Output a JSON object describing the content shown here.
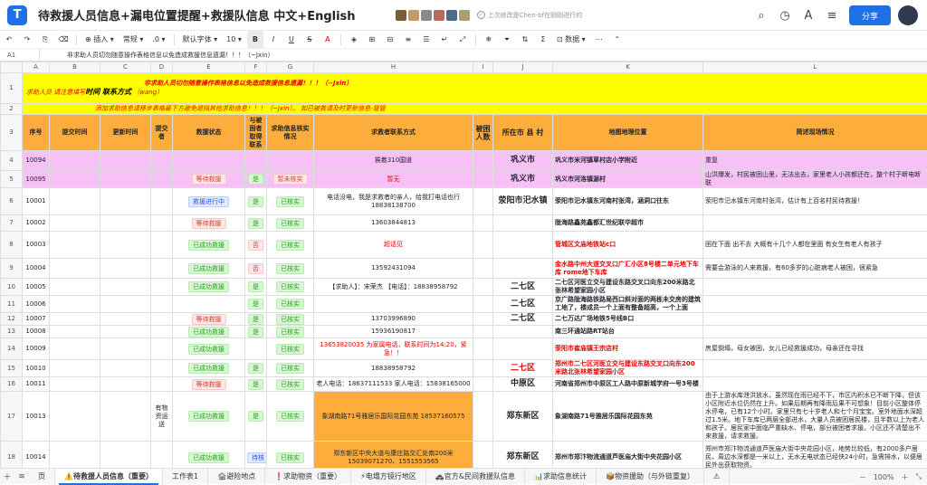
{
  "app": {
    "title": "待救援人员信息+漏电位置提醒+救援队信息 中文+English",
    "save_status": "上次修改是Chen-bf在刚刚进行的",
    "share_label": "分享",
    "logo": "doc-icon"
  },
  "toolbar": {
    "insert_label": "插入",
    "format_label": "常规",
    "decimal_label": ".0",
    "font_label": "默认字体",
    "size_label": "10",
    "data_label": "数据"
  },
  "formula_bar": {
    "cell_ref": "A1",
    "content": "非求助人员切勿随意操作表格信息以免造成救援信息遗漏！！！（~Jxin）"
  },
  "columns": [
    "A",
    "B",
    "C",
    "D",
    "E",
    "F",
    "G",
    "H",
    "I",
    "J",
    "K",
    "L"
  ],
  "banner": {
    "line1": "非求助人员切勿随意操作表格信息以免造成救援信息遗漏！！！（~Jxin）",
    "line2a": "求助人员 请注意填写",
    "line2b": "时间 联系方式",
    "line2c": "（wang）",
    "line3": "添加求助信息请移步表格最下方避免遮挡其他求助信息！！！（~Jxin）。 如已被救请及时更新信息-管管"
  },
  "headers": {
    "a": "序号",
    "b": "提交时间",
    "c": "更新时间",
    "d": "提交者",
    "e": "救援状态",
    "f": "与被困者取得联系",
    "g": "求助信息核实情况",
    "h": "求救者联系方式",
    "i": "被困人数",
    "j": "所在市 县 村",
    "k": "地图地理位置",
    "l": "简述现场情况"
  },
  "rows": [
    {
      "n": "4",
      "a": "10094",
      "e": "",
      "f": "",
      "g": "",
      "h": "挨着310国道",
      "j": "巩义市",
      "k": "巩义市米河镇草村店小学附近",
      "l": "重复",
      "pink": true
    },
    {
      "n": "5",
      "a": "10095",
      "e": "等待救援",
      "et": "wait",
      "f": "是",
      "ft": "yes",
      "g": "暂未核实",
      "gt": "unchecked",
      "h": "暂无",
      "hred": true,
      "j": "巩义市",
      "k": "巩义市河洛镇源村",
      "l": "山洪爆发，村民被困山里，无法出去，家里老人小孩都还在，整个村子断电断联",
      "pink": true
    },
    {
      "n": "6",
      "a": "10001",
      "e": "救援进行中",
      "et": "progress",
      "f": "是",
      "ft": "yes",
      "g": "已核实",
      "gt": "checked",
      "h": "电话没电，我是求救者的亲人，给我打电话也行 18838138700",
      "j": "荥阳市汜水镇",
      "k": "荥阳市汜水镇东河南村张湾，涵洞口往东",
      "l": "荥阳市汜水镇东河南村张湾，估计有上百名村民待救援！"
    },
    {
      "n": "7",
      "a": "10002",
      "e": "等待救援",
      "et": "wait",
      "f": "是",
      "ft": "yes",
      "g": "已核实",
      "gt": "checked",
      "h": "13603844813",
      "j": "",
      "k": "陇海路鑫苑鑫都汇世纪联华超市",
      "l": ""
    },
    {
      "n": "8",
      "a": "10003",
      "e": "已成功救援",
      "et": "done",
      "f": "否",
      "ft": "no",
      "g": "已核实",
      "gt": "checked",
      "h": "超话见",
      "hred": true,
      "j": "",
      "k": "管城区文庙地铁站c口",
      "kred": true,
      "l": "困在下面 出不去 大概有十几个人都在里面 有女生有老人有孩子"
    },
    {
      "n": "9",
      "a": "10004",
      "e": "已成功救援",
      "et": "done",
      "f": "否",
      "ft": "no",
      "g": "已核实",
      "gt": "checked",
      "h": "13592431094",
      "j": "",
      "k": "金水路中州大道交叉口广汇小区8号楼二单元地下车库 rome地下车库",
      "kred": true,
      "l": "需要会游泳的人来救援，有60多岁的心脏病老人被困，很紧急"
    },
    {
      "n": "10",
      "a": "10005",
      "e": "已成功救援",
      "et": "done",
      "f": "是",
      "ft": "yes",
      "g": "已核实",
      "gt": "checked",
      "h": "【求助人】：宋荣杰 【电话】：18838958792",
      "j": "二七区",
      "k": "二七区河医立交与建设东路交叉口向东200米路北张林希望家园小区",
      "l": ""
    },
    {
      "n": "11",
      "a": "10006",
      "e": "",
      "f": "是",
      "ft": "yes",
      "g": "已核实",
      "gt": "checked",
      "h": "",
      "j": "二七区",
      "k": "京广路陇海路铁路局西口斜对面的两栋未交房的建筑工地了，楼成员一个上面有整备超高，一个上面",
      "l": ""
    },
    {
      "n": "12",
      "a": "10007",
      "e": "等待救援",
      "et": "wait",
      "f": "是",
      "ft": "yes",
      "g": "已核实",
      "gt": "checked",
      "h": "13703996890",
      "j": "二七区",
      "k": "二七万达广场地铁5号线B口",
      "l": ""
    },
    {
      "n": "13",
      "a": "10008",
      "e": "已成功救援",
      "et": "done",
      "f": "是",
      "ft": "yes",
      "g": "已核实",
      "gt": "checked",
      "h": "15936190817",
      "j": "",
      "k": "南三环通站路RT站台",
      "l": ""
    },
    {
      "n": "14",
      "a": "10009",
      "e": "已成功救援",
      "et": "done",
      "f": "",
      "g": "已核实",
      "gt": "checked",
      "h": "13653820035 为家属电话，联系时间为14:20，紧急！！",
      "hred": true,
      "j": "",
      "k": "荥阳市崔庙镇王宗店村",
      "kred": true,
      "l": "房屋倒塌，母女被困，女儿已经救援成功，母亲还在寻找"
    },
    {
      "n": "15",
      "a": "10010",
      "e": "已成功救援",
      "et": "done",
      "f": "是",
      "ft": "yes",
      "g": "已核实",
      "gt": "checked",
      "h": "18838958792",
      "j": "二七区",
      "jred": true,
      "k": "郑州市二七区河医立交与建设东路交叉口向东200米路北张林希望家园小区",
      "kred": true,
      "l": ""
    },
    {
      "n": "16",
      "a": "10011",
      "e": "等待救援",
      "et": "wait",
      "f": "是",
      "ft": "yes",
      "g": "已核实",
      "gt": "checked",
      "h": "老人电话：18637111533 家人电话：15838165000",
      "j": "中原区",
      "k": "河南省郑州市中原区工人路中原新城学府一号3号楼",
      "l": ""
    },
    {
      "n": "17",
      "a": "10013",
      "d": "有物资运送",
      "e": "已成功救援",
      "et": "done",
      "f": "是",
      "ft": "yes",
      "g": "已核实",
      "gt": "checked",
      "h": "象湖南路71号雅居乐国际花园东苑 18537160575",
      "horange": true,
      "j": "郑东新区",
      "k": "象湖南路71号雅居乐国际花园东苑",
      "l": "由于上游水库泄洪放水，虽然现在雨已经不下，市区内积水已不断下降，但该小区附近水位仍然在上升。如果后期再有降雨后果不可想象！目前小区整体停水停电，已有12个小时。家里只有七十岁老人和七个月宝宝。室外地面水深超过1.5米。地下车库已两层全部进水，大量人员被困居民楼，且半数以上为老人和孩子。居民家中面临严重缺水、停电，部分被困者求援。小区还不清楚出不来救援，请求救援。"
    },
    {
      "n": "18",
      "a": "10014",
      "e": "已成功救援",
      "et": "done",
      "f": "待核",
      "ft": "wait2",
      "g": "已核实",
      "gt": "checked",
      "h": "郑东新区中央大道与康庄路交汇处南200米 15039071270、1551553565",
      "horange": true,
      "j": "郑东新区",
      "k": "郑州市郑汴物流通道芦医庙大街中央花园小区",
      "l": "郑州市郑汴物流通道芦医庙大街中央花园小区，地势比较低，有2000多户居民，周边水深都是一米以上，无水无电状态已经快24小时，急需排水，以便居民外出获取物资。"
    },
    {
      "n": "19",
      "a": "10015",
      "e": "已成功救援",
      "et": "done",
      "f": "是",
      "ft": "yes",
      "g": "已核实",
      "gt": "checked",
      "h": "郑东新区中央大道与康庄路交汇处南200米",
      "horange": true,
      "j": "郑东新区",
      "k": "郑州市郑汴物流通道芦医庙大街中央花园小区",
      "l": "郑州市郑汴物流通道芦医庙大街中央花园小区，地势比较低，有2000多户居民，周边水深都是一米以上，无水无电状态已经快24小时，急需排水，以便居民外出获取"
    }
  ],
  "sheet_tabs": [
    "页",
    "⚠️待救援人员信息（重要）",
    "工作表1",
    "🏚避险地点",
    "❗求助物资（重要）",
    "⚡电塌方镜行地区",
    "🚓官方&民间救援队信息",
    "📊求助信息统计",
    "📦物资援助（与外链重复）",
    "⚠"
  ],
  "zoom": "100%"
}
